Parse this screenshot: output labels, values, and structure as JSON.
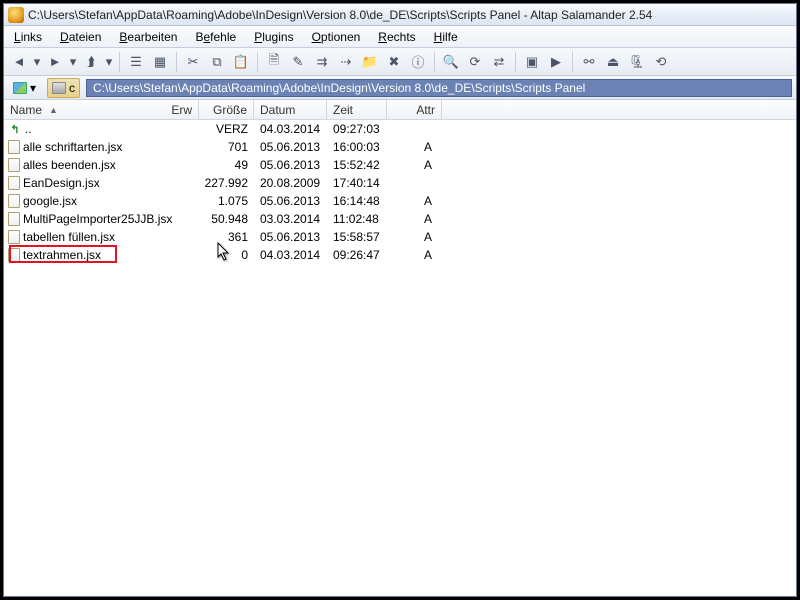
{
  "window": {
    "title": "C:\\Users\\Stefan\\AppData\\Roaming\\Adobe\\InDesign\\Version 8.0\\de_DE\\Scripts\\Scripts Panel - Altap Salamander 2.54"
  },
  "menu": {
    "links": "Links",
    "dateien": "Dateien",
    "bearbeiten": "Bearbeiten",
    "befehle": "Befehle",
    "plugins": "Plugins",
    "optionen": "Optionen",
    "rechts": "Rechts",
    "hilfe": "Hilfe"
  },
  "drive": {
    "c": "c"
  },
  "path": "C:\\Users\\Stefan\\AppData\\Roaming\\Adobe\\InDesign\\Version 8.0\\de_DE\\Scripts\\Scripts Panel",
  "headers": {
    "name": "Name",
    "erw": "Erw",
    "size": "Größe",
    "date": "Datum",
    "time": "Zeit",
    "attr": "Attr"
  },
  "up": {
    "label": "..",
    "size": "VERZ",
    "date": "04.03.2014",
    "time": "09:27:03",
    "attr": ""
  },
  "rows": [
    {
      "name": "alle schriftarten.jsx",
      "size": "701",
      "date": "05.06.2013",
      "time": "16:00:03",
      "attr": "A"
    },
    {
      "name": "alles beenden.jsx",
      "size": "49",
      "date": "05.06.2013",
      "time": "15:52:42",
      "attr": "A"
    },
    {
      "name": "EanDesign.jsx",
      "size": "227.992",
      "date": "20.08.2009",
      "time": "17:40:14",
      "attr": ""
    },
    {
      "name": "google.jsx",
      "size": "1.075",
      "date": "05.06.2013",
      "time": "16:14:48",
      "attr": "A"
    },
    {
      "name": "MultiPageImporter25JJB.jsx",
      "size": "50.948",
      "date": "03.03.2014",
      "time": "11:02:48",
      "attr": "A"
    },
    {
      "name": "tabellen füllen.jsx",
      "size": "361",
      "date": "05.06.2013",
      "time": "15:58:57",
      "attr": "A"
    },
    {
      "name": "textrahmen.jsx",
      "size": "0",
      "date": "04.03.2014",
      "time": "09:26:47",
      "attr": "A"
    }
  ]
}
